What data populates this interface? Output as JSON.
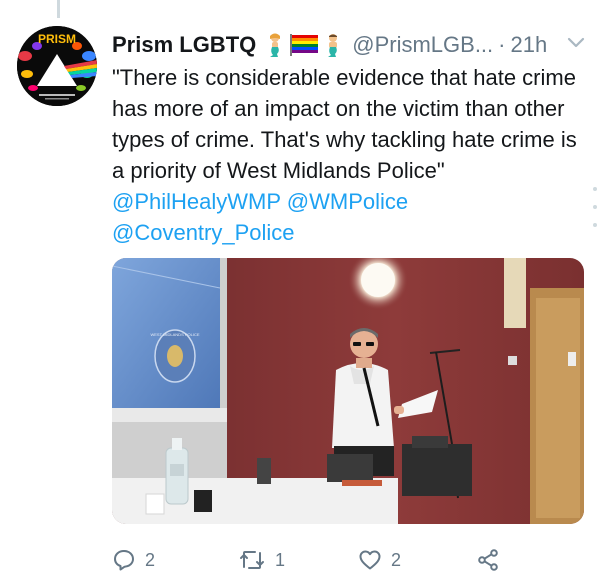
{
  "tweet": {
    "display_name": "Prism LGBTQ",
    "handle": "@PrismLGB...",
    "separator": "·",
    "time": "21h",
    "text_parts": [
      "\"There is considerable evidence that hate crime has more of an impact on the victim than other types of crime. That's why tackling hate crime is a priority of West Midlands Police\" ",
      "@PhilHealyWMP",
      " ",
      "@WMPolice",
      " ",
      "@Coventry_Police"
    ],
    "avatar_text": "PRISM",
    "photo_emblem_text": "WEST MIDLANDS POLICE",
    "emoji_icons": [
      "mermaid-icon",
      "rainbow-flag-icon",
      "merman-icon"
    ]
  },
  "actions": {
    "reply_count": "2",
    "retweet_count": "1",
    "like_count": "2",
    "share_label": ""
  },
  "colors": {
    "text": "#14171a",
    "secondary": "#657786",
    "link": "#1da1f2",
    "divider": "#cfd9de"
  }
}
